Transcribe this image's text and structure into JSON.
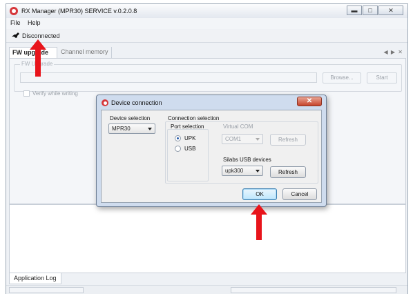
{
  "app": {
    "title": "RX Manager (MPR30) SERVICE v.0.2.0.8",
    "window_buttons": [
      "minimize",
      "maximize",
      "close"
    ]
  },
  "menu": {
    "items": [
      "File",
      "Help"
    ]
  },
  "toolbar": {
    "connection_status": "Disconnected",
    "icon": "plug-icon"
  },
  "tabs": {
    "items": [
      "FW upgrade",
      "Channel memory"
    ],
    "active": "FW upgrade"
  },
  "fw_upgrade": {
    "group_title": "FW Upgrade",
    "path_value": "",
    "browse_label": "Browse...",
    "start_label": "Start",
    "verify_label": "Verify while writing",
    "verify_checked": false
  },
  "bottom_tab": {
    "label": "Application Log"
  },
  "dialog": {
    "title": "Device connection",
    "device_selection": {
      "label": "Device selection",
      "value": "MPR30"
    },
    "connection_selection": {
      "label": "Connection selection",
      "port_selection_label": "Port selection",
      "ports": [
        {
          "label": "UPK",
          "checked": true
        },
        {
          "label": "USB",
          "checked": false
        }
      ],
      "virtual_com": {
        "label": "Virtual COM",
        "value": "COM1",
        "refresh_label": "Refresh",
        "enabled": false
      },
      "silabs": {
        "label": "Silabs USB devices",
        "value": "upk300",
        "refresh_label": "Refresh",
        "enabled": true
      }
    },
    "ok_label": "OK",
    "cancel_label": "Cancel"
  },
  "annotation": {
    "arrow_color": "#e8141b"
  }
}
